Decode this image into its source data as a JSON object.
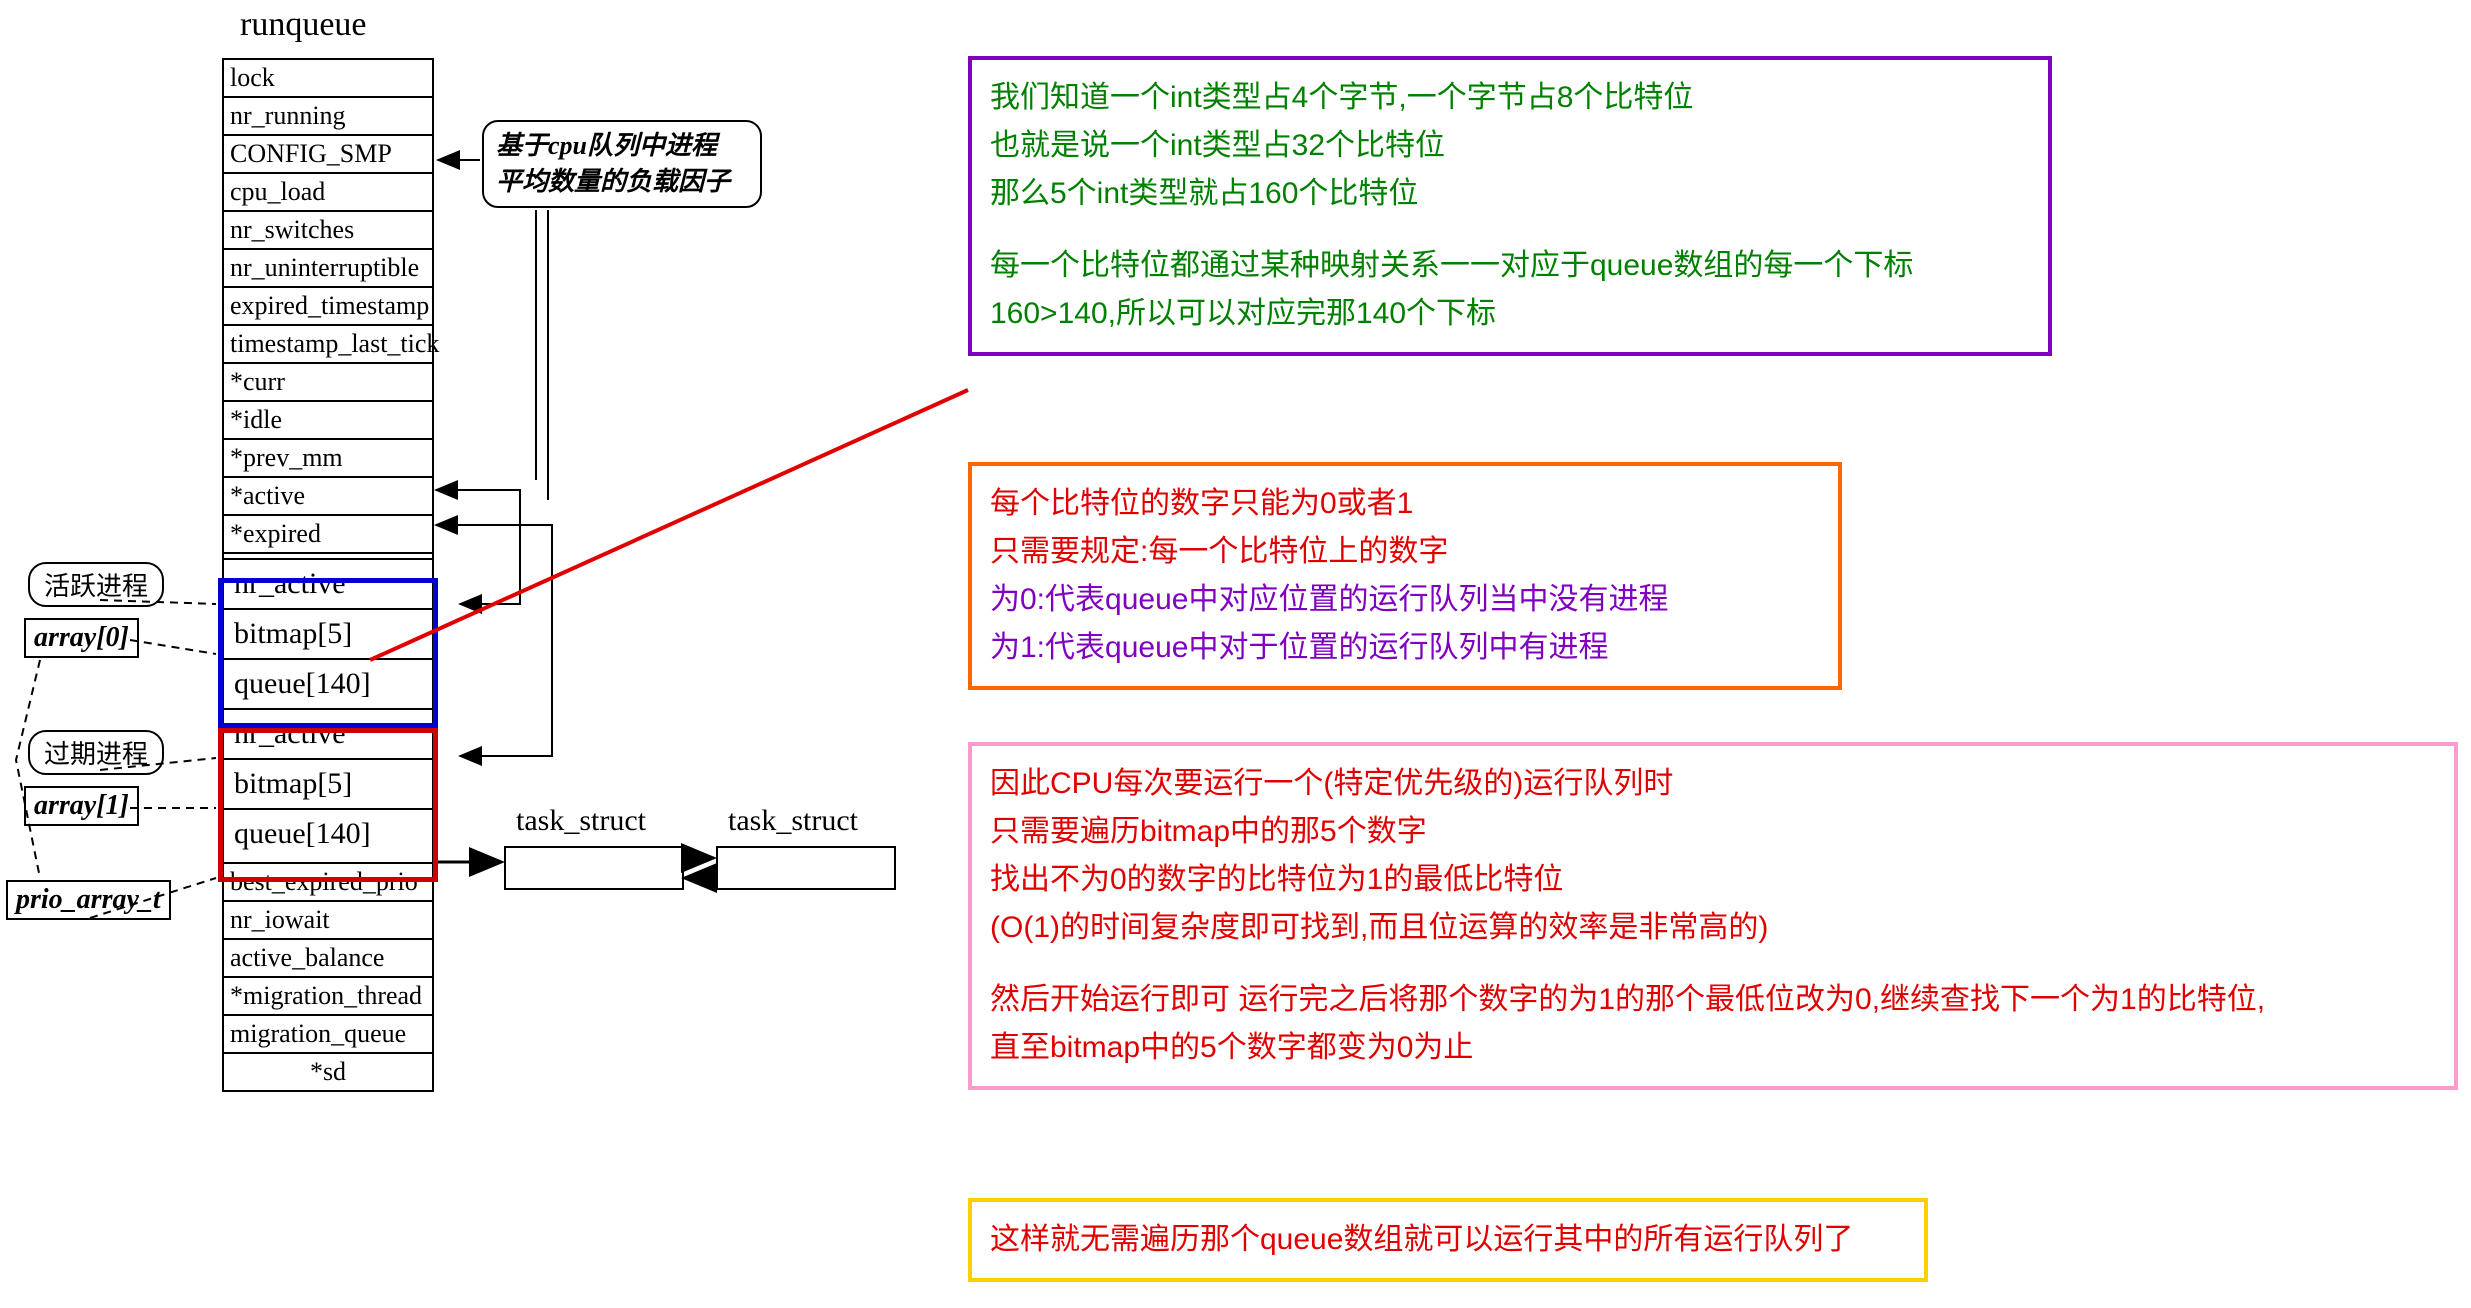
{
  "title": "runqueue",
  "struct_rows": {
    "r0": "lock",
    "r1": "nr_running",
    "r2": "CONFIG_SMP",
    "r3": "cpu_load",
    "r4": "nr_switches",
    "r5": "nr_uninterruptible",
    "r6": "expired_timestamp",
    "r7": "timestamp_last_tick",
    "r8": "*curr",
    "r9": "*idle",
    "r10": "*prev_mm",
    "r11": "*active",
    "r12": "*expired",
    "g0_0": "nr_active",
    "g0_1": "bitmap[5]",
    "g0_2": "queue[140]",
    "g1_0": "nr_active",
    "g1_1": "bitmap[5]",
    "g1_2": "queue[140]",
    "r13": "best_expired_prio",
    "r14": "nr_iowait",
    "r15": "active_balance",
    "r16": "*migration_thread",
    "r17": "migration_queue",
    "r18": "*sd"
  },
  "callout": {
    "line1": "基于cpu队列中进程",
    "line2": "平均数量的负载因子"
  },
  "bubbles": {
    "active_proc": "活跃进程",
    "expired_proc": "过期进程"
  },
  "labels": {
    "array0": "array[0]",
    "array1": "array[1]",
    "prio_array_t": "prio_array_t",
    "task_struct": "task_struct"
  },
  "notes": {
    "purple": {
      "l1": "我们知道一个int类型占4个字节,一个字节占8个比特位",
      "l2": "也就是说一个int类型占32个比特位",
      "l3": "那么5个int类型就占160个比特位",
      "l4": "每一个比特位都通过某种映射关系一一对应于queue数组的每一个下标",
      "l5": "160>140,所以可以对应完那140个下标"
    },
    "orange": {
      "l1": "每个比特位的数字只能为0或者1",
      "l2": "只需要规定:每一个比特位上的数字",
      "l3": "为0:代表queue中对应位置的运行队列当中没有进程",
      "l4": "为1:代表queue中对于位置的运行队列中有进程"
    },
    "pink": {
      "l1": "因此CPU每次要运行一个(特定优先级的)运行队列时",
      "l2": "只需要遍历bitmap中的那5个数字",
      "l3": "找出不为0的数字的比特位为1的最低比特位",
      "l4": "(O(1)的时间复杂度即可找到,而且位运算的效率是非常高的)",
      "l5": "然后开始运行即可    运行完之后将那个数字的为1的那个最低位改为0,继续查找下一个为1的比特位,",
      "l6": "直至bitmap中的5个数字都变为0为止"
    },
    "yellow": {
      "l1": "这样就无需遍历那个queue数组就可以运行其中的所有运行队列了"
    }
  }
}
